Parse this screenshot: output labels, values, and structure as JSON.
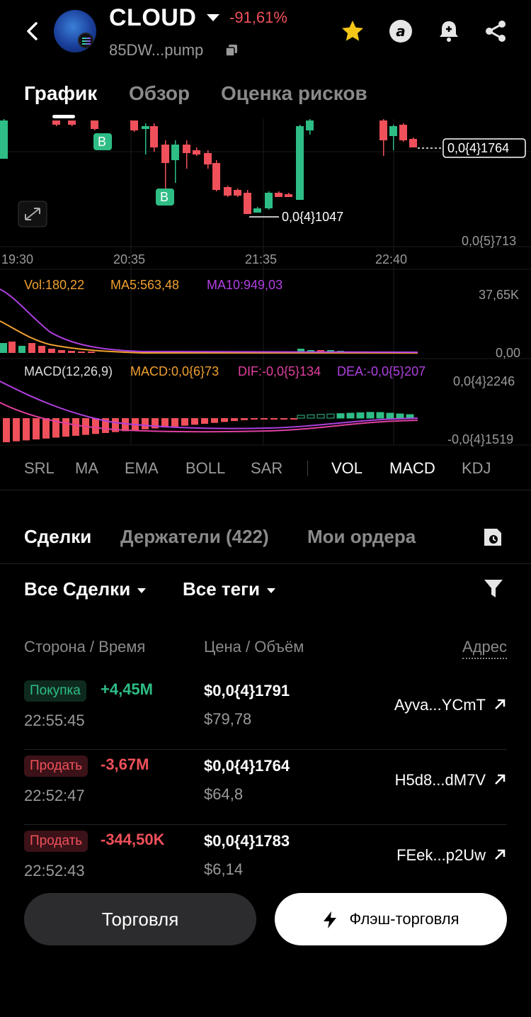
{
  "header": {
    "token_name": "CLOUD",
    "price_change": "-91,61%",
    "contract_short": "85DW...pump"
  },
  "tabs": [
    "График",
    "Обзор",
    "Оценка рисков"
  ],
  "chart": {
    "price_label": "0,0{4}1764",
    "low_label": "0,0{4}1047",
    "min_axis": "0,0{5}713",
    "time_ticks": [
      "19:30",
      "20:35",
      "21:35",
      "22:40"
    ],
    "buy_marker": "B"
  },
  "volume_panel": {
    "vol": "Vol:180,22",
    "ma5": "MA5:563,48",
    "ma10": "MA10:949,03",
    "top": "37,65K",
    "bottom": "0,00"
  },
  "macd_panel": {
    "name": "MACD(12,26,9)",
    "macd": "MACD:0,0{6}73",
    "dif": "DIF:-0,0{5}134",
    "dea": "DEA:-0,0{5}207",
    "top": "0,0{4}2246",
    "bottom": "-0,0{4}1519"
  },
  "indicators": {
    "main": [
      "SRL",
      "MA",
      "EMA",
      "BOLL",
      "SAR"
    ],
    "sub": [
      "VOL",
      "MACD",
      "KDJ"
    ]
  },
  "section_tabs": [
    "Сделки",
    "Держатели (422)",
    "Мои ордера"
  ],
  "filters": {
    "trades": "Все Сделки",
    "tags": "Все теги"
  },
  "columns": {
    "side_time": "Сторона / Время",
    "price_volume": "Цена / Объём",
    "address": "Адрес"
  },
  "trades": [
    {
      "side": "Покупка",
      "type": "buy",
      "amount": "+4,45M",
      "time": "22:55:45",
      "price": "$0,0{4}1791",
      "volume": "$79,78",
      "address": "Ayva...YCmT"
    },
    {
      "side": "Продать",
      "type": "sell",
      "amount": "-3,67M",
      "time": "22:52:47",
      "price": "$0,0{4}1764",
      "volume": "$64,8",
      "address": "H5d8...dM7V"
    },
    {
      "side": "Продать",
      "type": "sell",
      "amount": "-344,50K",
      "time": "22:52:43",
      "price": "$0,0{4}1783",
      "volume": "$6,14",
      "address": "FEek...p2Uw"
    }
  ],
  "buttons": {
    "trade": "Торговля",
    "flash": "Флэш-торговля"
  },
  "colors": {
    "up": "#2ebd85",
    "down": "#f0505a",
    "ma5": "#f0a030",
    "ma10": "#b040e0",
    "dif": "#e040a0",
    "dea": "#b040e0"
  }
}
